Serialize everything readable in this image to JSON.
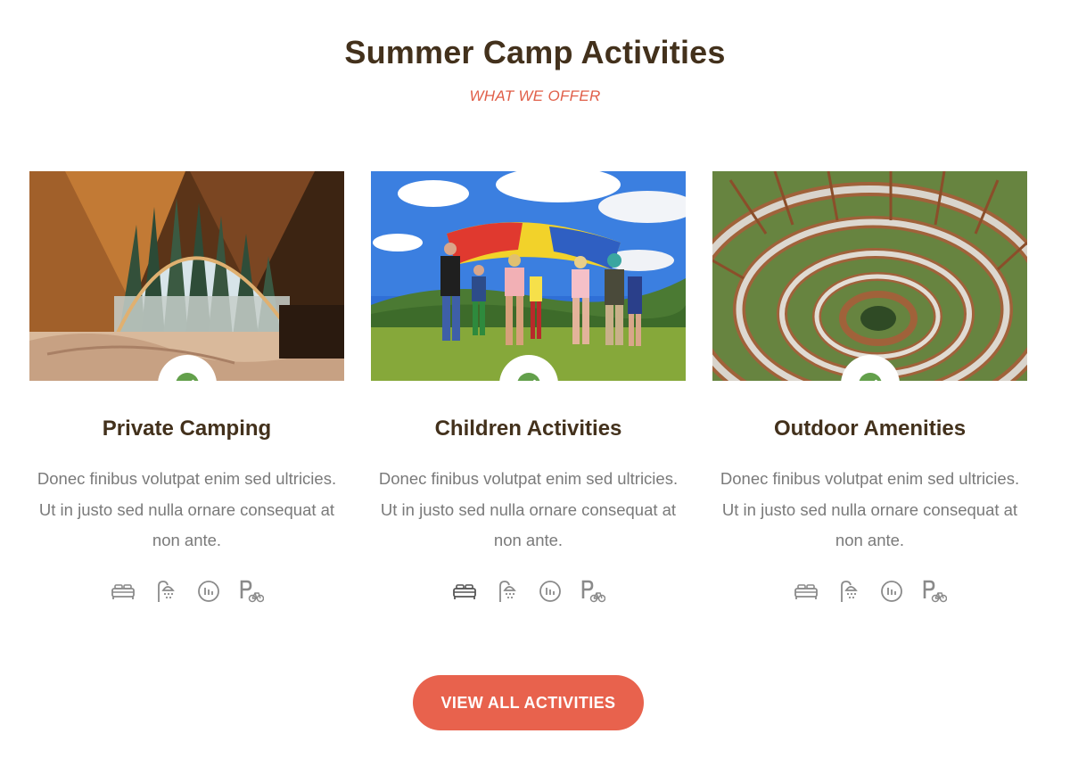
{
  "section": {
    "title": "Summer Camp Activities",
    "subtitle": "WHAT WE OFFER"
  },
  "cards": [
    {
      "title": "Private Camping",
      "description": "Donec finibus volutpat enim sed ultricies. Ut in justo sed nulla ornare consequat at non ante.",
      "image": "tent-view-icon",
      "badge_icon": "check-icon",
      "amenities": [
        "bed-icon",
        "shower-icon",
        "sauna-icon",
        "bike-parking-icon"
      ]
    },
    {
      "title": "Children Activities",
      "description": "Donec finibus volutpat enim sed ultricies. Ut in justo sed nulla ornare consequat at non ante.",
      "image": "kids-parachute-icon",
      "badge_icon": "check-icon",
      "amenities": [
        "bed-icon",
        "shower-icon",
        "sauna-icon",
        "bike-parking-icon"
      ]
    },
    {
      "title": "Outdoor Amenities",
      "description": "Donec finibus volutpat enim sed ultricies. Ut in justo sed nulla ornare consequat at non ante.",
      "image": "spiral-walkway-icon",
      "badge_icon": "check-icon",
      "amenities": [
        "bed-icon",
        "shower-icon",
        "sauna-icon",
        "bike-parking-icon"
      ]
    }
  ],
  "cta": {
    "label": "VIEW ALL ACTIVITIES"
  },
  "colors": {
    "heading": "#43311c",
    "accent": "#e05f49",
    "button": "#e8624d",
    "check": "#63a04b",
    "body_text": "#7a7a7a",
    "icon": "#8a8a8a"
  }
}
